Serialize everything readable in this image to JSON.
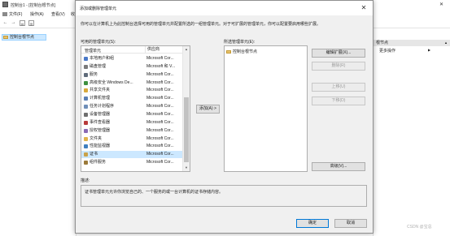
{
  "background_window": {
    "title": "控制台1 - [控制台根节点]",
    "menu": [
      {
        "label": "文件(F)"
      },
      {
        "label": "操作(A)"
      },
      {
        "label": "查看(V)"
      },
      {
        "label": "收..."
      }
    ],
    "tree_root": "控制台根节点",
    "actions_header": "根节点",
    "actions_more": "更多操作"
  },
  "dialog": {
    "title": "添加或删除管理单元",
    "description": "你可以在计算机上为此控制台选择可用的管理单元并配置所选的一组管理单元。对于可扩展的管理单元，你可以配置要启用哪些扩展。",
    "available_label": "可用的管理单元(S):",
    "columns": {
      "name": "管理单元",
      "vendor": "供应商"
    },
    "snapins": [
      {
        "name": "本地用户和组",
        "vendor": "Microsoft Cor...",
        "icon": "users-icon",
        "color": "#4a79c8"
      },
      {
        "name": "磁盘管理",
        "vendor": "Microsoft 和 V...",
        "icon": "disk-icon",
        "color": "#7a7a7a"
      },
      {
        "name": "服务",
        "vendor": "Microsoft Cor...",
        "icon": "gear-icon",
        "color": "#5f6b7a"
      },
      {
        "name": "高级安全 Windows De...",
        "vendor": "Microsoft Cor...",
        "icon": "firewall-icon",
        "color": "#3f8f3f"
      },
      {
        "name": "共享文件夹",
        "vendor": "Microsoft Cor...",
        "icon": "shared-folder-icon",
        "color": "#d9a93c"
      },
      {
        "name": "计算机管理",
        "vendor": "Microsoft Cor...",
        "icon": "computer-icon",
        "color": "#5b7fb4"
      },
      {
        "name": "任务计划程序",
        "vendor": "Microsoft Cor...",
        "icon": "clock-icon",
        "color": "#6f8fb8"
      },
      {
        "name": "设备管理器",
        "vendor": "Microsoft Cor...",
        "icon": "device-icon",
        "color": "#6e6e6e"
      },
      {
        "name": "事件查看器",
        "vendor": "Microsoft Cor...",
        "icon": "event-icon",
        "color": "#b83b3b"
      },
      {
        "name": "授权管理器",
        "vendor": "Microsoft Cor...",
        "icon": "authorization-icon",
        "color": "#8a6ab5"
      },
      {
        "name": "文件夹",
        "vendor": "Microsoft Cor...",
        "icon": "folder-icon",
        "color": "#e0b44a"
      },
      {
        "name": "性能监视器",
        "vendor": "Microsoft Cor...",
        "icon": "performance-icon",
        "color": "#3f7fbf"
      },
      {
        "name": "证书",
        "vendor": "Microsoft Cor...",
        "icon": "certificate-icon",
        "color": "#c9a24a"
      },
      {
        "name": "组件服务",
        "vendor": "Microsoft Cor...",
        "icon": "component-icon",
        "color": "#9b7a3a"
      }
    ],
    "selected_index": 12,
    "add_label": "添加(A) >",
    "selected_label": "所选管理单元(E):",
    "selected_items": [
      "控制台根节点"
    ],
    "buttons": {
      "edit_extensions": "编辑扩展(X)...",
      "remove": "删除(R)",
      "move_up": "上移(U)",
      "move_down": "下移(D)",
      "advanced": "高级(V)...",
      "ok": "确定",
      "cancel": "取消"
    },
    "desc_label": "描述:",
    "desc_text": "证书管理单元允许你浏览自己的、一个服务的或一台计算机的证书存储内容。"
  },
  "watermark": "CSDN @宝总",
  "colors": {
    "accent": "#0078d7",
    "selection": "#cce8ff"
  }
}
